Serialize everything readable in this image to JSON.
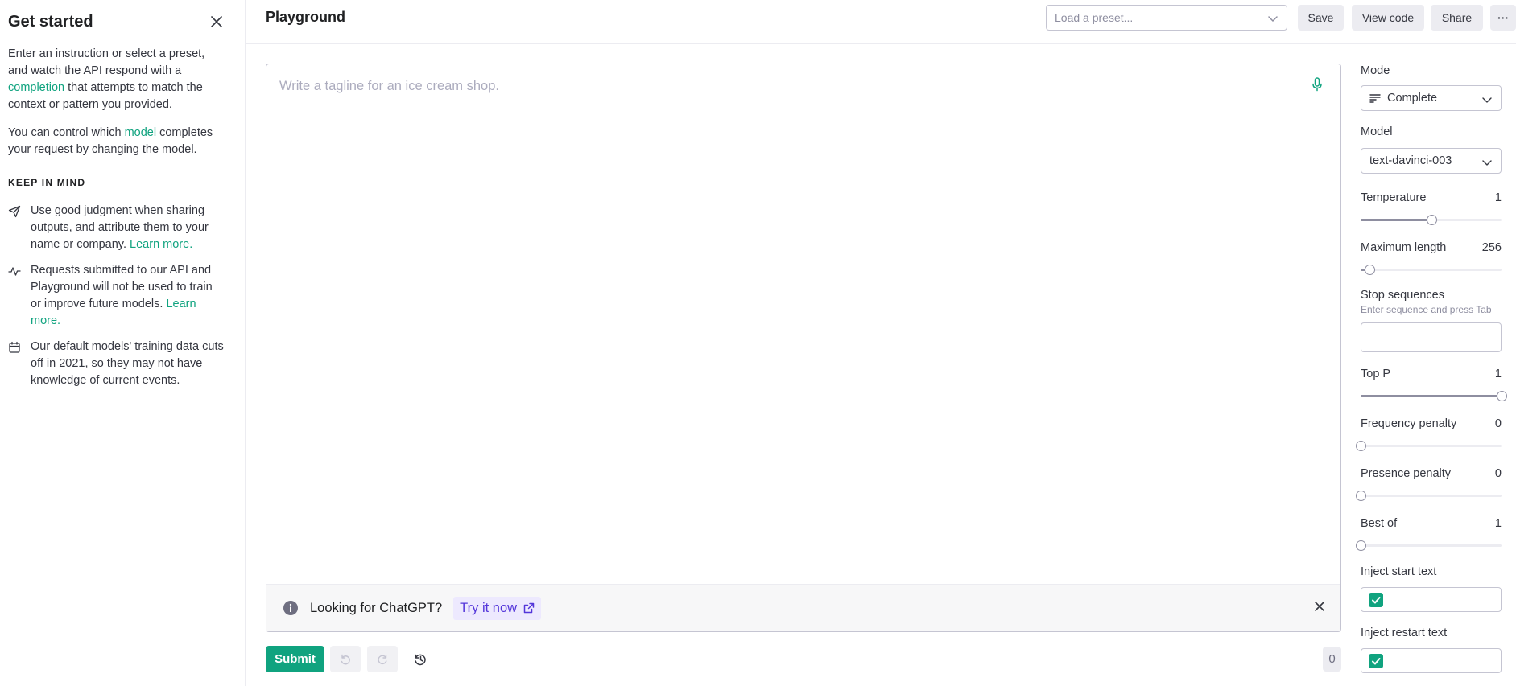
{
  "sidebar": {
    "title": "Get started",
    "intro": {
      "part1": "Enter an instruction or select a preset, and watch the API respond with a ",
      "link": "completion",
      "part2": " that attempts to match the context or pattern you provided."
    },
    "model_text": {
      "part1": "You can control which ",
      "link": "model",
      "part2": " completes your request by changing the model."
    },
    "keep_in_mind": "KEEP IN MIND",
    "tips": [
      {
        "icon": "send-icon",
        "text": "Use good judgment when sharing outputs, and attribute them to your name or company. ",
        "link": "Learn more."
      },
      {
        "icon": "activity-icon",
        "text": "Requests submitted to our API and Playground will not be used to train or improve future models. ",
        "link": "Learn more."
      },
      {
        "icon": "calendar-icon",
        "text": "Our default models' training data cuts off in 2021, so they may not have knowledge of current events.",
        "link": ""
      }
    ]
  },
  "header": {
    "title": "Playground",
    "preset_placeholder": "Load a preset...",
    "save_label": "Save",
    "view_code_label": "View code",
    "share_label": "Share",
    "more_label": "···"
  },
  "editor": {
    "placeholder": "Write a tagline for an ice cream shop.",
    "banner_text": "Looking for ChatGPT?",
    "try_label": "Try it now"
  },
  "toolbar": {
    "submit_label": "Submit",
    "token_count": "0"
  },
  "panel": {
    "mode_label": "Mode",
    "mode_value": "Complete",
    "model_label": "Model",
    "model_value": "text-davinci-003",
    "temperature_label": "Temperature",
    "temperature_value": "1",
    "temperature_fraction": 0.5,
    "max_length_label": "Maximum length",
    "max_length_value": "256",
    "max_length_fraction": 0.06,
    "stop_label": "Stop sequences",
    "stop_hint": "Enter sequence and press Tab",
    "top_p_label": "Top P",
    "top_p_value": "1",
    "top_p_fraction": 1.0,
    "freq_label": "Frequency penalty",
    "freq_value": "0",
    "freq_fraction": 0.0,
    "pres_label": "Presence penalty",
    "pres_value": "0",
    "pres_fraction": 0.0,
    "best_of_label": "Best of",
    "best_of_value": "1",
    "best_of_fraction": 0.0,
    "inject_start_label": "Inject start text",
    "inject_restart_label": "Inject restart text"
  },
  "colors": {
    "accent": "#10a37f",
    "try_bg": "#ede9fe",
    "try_text": "#5436da"
  }
}
